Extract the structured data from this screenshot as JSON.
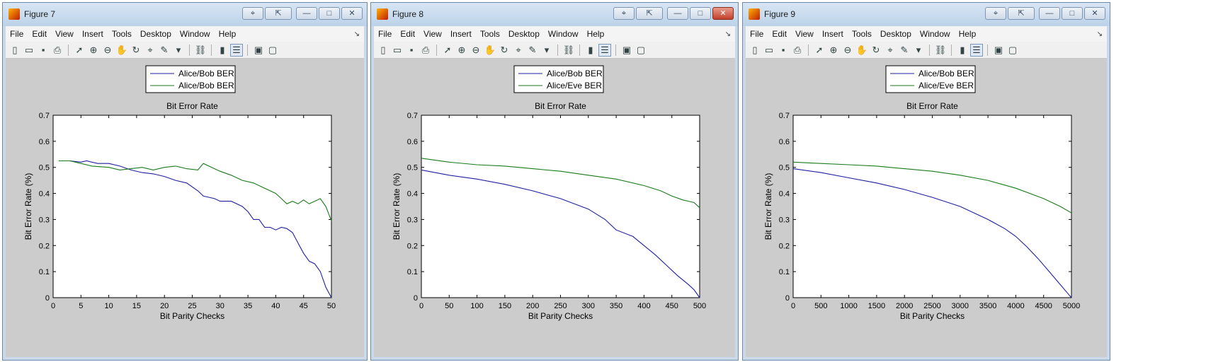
{
  "menu": [
    "File",
    "Edit",
    "View",
    "Insert",
    "Tools",
    "Desktop",
    "Window",
    "Help"
  ],
  "menu_arrow": "↘",
  "window_controls": [
    "⌖",
    "⇱",
    "—",
    "□",
    "✕"
  ],
  "toolbar_icons": [
    "new-file-icon",
    "open-folder-icon",
    "save-icon",
    "print-icon",
    "sep",
    "pointer-icon",
    "zoom-in-icon",
    "zoom-out-icon",
    "pan-hand-icon",
    "rotate-3d-icon",
    "data-cursor-icon",
    "brush-icon",
    "brush-dropdown-icon",
    "sep",
    "link-plot-icon",
    "sep",
    "colorbar-icon",
    "legend-icon",
    "sep",
    "hide-plot-tools-icon",
    "show-plot-tools-icon"
  ],
  "colors": {
    "bob": "#1f1fa0",
    "eve": "#1a7a1a",
    "figure_bg": "#cccccc"
  },
  "windows": [
    {
      "title": "Figure 7",
      "active": false,
      "chart_data": {
        "type": "line",
        "title": "Bit Error Rate",
        "xlabel": "Bit Parity Checks",
        "ylabel": "Bit Error Rate (%)",
        "xlim": [
          0,
          50
        ],
        "ylim": [
          0,
          0.7
        ],
        "xticks": [
          0,
          5,
          10,
          15,
          20,
          25,
          30,
          35,
          40,
          45,
          50
        ],
        "yticks": [
          0,
          0.1,
          0.2,
          0.3,
          0.4,
          0.5,
          0.6,
          0.7
        ],
        "legend": "top-center",
        "series": [
          {
            "name": "Alice/Bob BER",
            "color": "bob",
            "x": [
              1,
              3,
              5,
              6,
              8,
              10,
              12,
              14,
              16,
              18,
              20,
              22,
              24,
              26,
              27,
              29,
              30,
              32,
              34,
              35,
              36,
              37,
              38,
              39,
              40,
              41,
              42,
              43,
              44,
              45,
              46,
              47,
              48,
              49,
              50
            ],
            "y": [
              0.525,
              0.525,
              0.52,
              0.525,
              0.515,
              0.515,
              0.505,
              0.49,
              0.48,
              0.475,
              0.465,
              0.45,
              0.44,
              0.41,
              0.39,
              0.38,
              0.37,
              0.37,
              0.35,
              0.33,
              0.3,
              0.3,
              0.27,
              0.27,
              0.26,
              0.27,
              0.265,
              0.25,
              0.21,
              0.17,
              0.14,
              0.13,
              0.1,
              0.04,
              0.0
            ]
          },
          {
            "name": "Alice/Bob BER",
            "color": "eve",
            "x": [
              1,
              3,
              5,
              7,
              10,
              12,
              14,
              16,
              18,
              20,
              22,
              24,
              26,
              27,
              29,
              30,
              32,
              34,
              36,
              38,
              40,
              41,
              42,
              43,
              44,
              45,
              46,
              47,
              48,
              49,
              50
            ],
            "y": [
              0.525,
              0.525,
              0.515,
              0.505,
              0.5,
              0.49,
              0.495,
              0.5,
              0.49,
              0.5,
              0.505,
              0.495,
              0.49,
              0.515,
              0.495,
              0.485,
              0.47,
              0.45,
              0.44,
              0.42,
              0.4,
              0.38,
              0.36,
              0.37,
              0.36,
              0.375,
              0.36,
              0.37,
              0.38,
              0.35,
              0.295
            ]
          }
        ]
      }
    },
    {
      "title": "Figure 8",
      "active": true,
      "chart_data": {
        "type": "line",
        "title": "Bit Error Rate",
        "xlabel": "Bit Parity Checks",
        "ylabel": "Bit Error Rate (%)",
        "xlim": [
          0,
          500
        ],
        "ylim": [
          0,
          0.7
        ],
        "xticks": [
          0,
          50,
          100,
          150,
          200,
          250,
          300,
          350,
          400,
          450,
          500
        ],
        "yticks": [
          0,
          0.1,
          0.2,
          0.3,
          0.4,
          0.5,
          0.6,
          0.7
        ],
        "legend": "top-center",
        "series": [
          {
            "name": "Alice/Bob BER",
            "color": "bob",
            "x": [
              0,
              50,
              100,
              150,
              200,
              250,
              300,
              330,
              350,
              380,
              400,
              420,
              440,
              460,
              480,
              490,
              500
            ],
            "y": [
              0.49,
              0.47,
              0.455,
              0.435,
              0.41,
              0.38,
              0.34,
              0.3,
              0.26,
              0.235,
              0.2,
              0.165,
              0.125,
              0.085,
              0.05,
              0.03,
              0.0
            ]
          },
          {
            "name": "Alice/Eve BER",
            "color": "eve",
            "x": [
              0,
              50,
              100,
              150,
              200,
              250,
              300,
              350,
              400,
              430,
              450,
              470,
              480,
              490,
              500
            ],
            "y": [
              0.535,
              0.52,
              0.51,
              0.505,
              0.495,
              0.485,
              0.47,
              0.455,
              0.43,
              0.41,
              0.39,
              0.375,
              0.37,
              0.365,
              0.345
            ]
          }
        ]
      }
    },
    {
      "title": "Figure 9",
      "active": false,
      "chart_data": {
        "type": "line",
        "title": "Bit Error Rate",
        "xlabel": "Bit Parity Checks",
        "ylabel": "Bit Error Rate (%)",
        "xlim": [
          0,
          5000
        ],
        "ylim": [
          0,
          0.7
        ],
        "xticks": [
          0,
          500,
          1000,
          1500,
          2000,
          2500,
          3000,
          3500,
          4000,
          4500,
          5000
        ],
        "yticks": [
          0,
          0.1,
          0.2,
          0.3,
          0.4,
          0.5,
          0.6,
          0.7
        ],
        "legend": "top-center",
        "series": [
          {
            "name": "Alice/Bob BER",
            "color": "bob",
            "x": [
              0,
              500,
              1000,
              1500,
              2000,
              2500,
              3000,
              3500,
              3800,
              4000,
              4200,
              4400,
              4600,
              4800,
              4900,
              5000
            ],
            "y": [
              0.495,
              0.48,
              0.46,
              0.44,
              0.415,
              0.385,
              0.35,
              0.3,
              0.265,
              0.235,
              0.195,
              0.15,
              0.1,
              0.05,
              0.025,
              0.0
            ]
          },
          {
            "name": "Alice/Eve BER",
            "color": "eve",
            "x": [
              0,
              500,
              1000,
              1500,
              2000,
              2500,
              3000,
              3500,
              4000,
              4500,
              4800,
              5000
            ],
            "y": [
              0.52,
              0.515,
              0.51,
              0.505,
              0.495,
              0.485,
              0.47,
              0.45,
              0.42,
              0.38,
              0.35,
              0.325
            ]
          }
        ]
      }
    }
  ]
}
